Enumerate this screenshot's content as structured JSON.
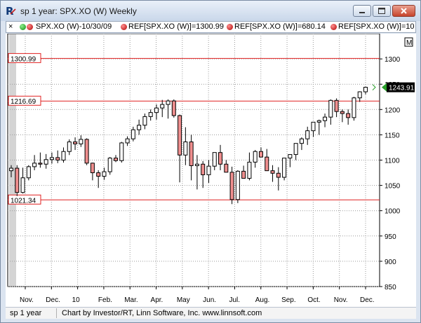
{
  "window": {
    "title": "sp 1 year: SPX.XO (W) Weekly"
  },
  "infobar": {
    "close_glyph": "×",
    "icons": [
      "green-dot-icon",
      "red-dot-icon"
    ],
    "symbol_label": "SPX.XO (W)-10/30/09",
    "ref1_label": "REF[SPX.XO (W)]=1300.99",
    "ref2_label": "REF[SPX.XO (W)]=680.14",
    "ref3_label": "REF[SPX.XO (W)]=10"
  },
  "status": {
    "chart_name": "sp 1 year",
    "credit": "Chart by Investor/RT, Linn Software, Inc. www.linnsoft.com"
  },
  "colors": {
    "up_candle": "#ffffff",
    "down_candle": "#f08f8f",
    "ref_line": "#e02020",
    "last_price_bg": "#000000",
    "last_price_marker": "#2aa02a",
    "highlight_column": "#d4d4d4"
  },
  "chart_data": {
    "type": "candlestick",
    "y_axis": {
      "min": 850,
      "max": 1350,
      "ticks": [
        850,
        900,
        950,
        1000,
        1050,
        1100,
        1150,
        1200,
        1250,
        1300
      ],
      "side": "right"
    },
    "x_tick_labels": [
      "Nov.",
      "Dec.",
      "10",
      "Feb.",
      "Mar.",
      "Apr.",
      "May",
      "Jun.",
      "Jul.",
      "Aug.",
      "Sep.",
      "Oct.",
      "Nov.",
      "Dec."
    ],
    "grid": true,
    "reference_lines": [
      {
        "label": "1300.99",
        "value": 1300.99
      },
      {
        "label": "1216.69",
        "value": 1216.69
      },
      {
        "label": "1021.34",
        "value": 1021.34
      }
    ],
    "last_price": {
      "label": "1243.91",
      "value": 1243.91
    },
    "corner_marker": "M",
    "candles": [
      [
        1079,
        1090,
        1066,
        1084
      ],
      [
        1084,
        1090,
        1029,
        1036
      ],
      [
        1036,
        1085,
        1034,
        1065
      ],
      [
        1065,
        1090,
        1060,
        1087
      ],
      [
        1087,
        1110,
        1080,
        1094
      ],
      [
        1094,
        1115,
        1085,
        1092
      ],
      [
        1092,
        1112,
        1083,
        1101
      ],
      [
        1101,
        1115,
        1093,
        1105
      ],
      [
        1105,
        1119,
        1094,
        1100
      ],
      [
        1100,
        1125,
        1095,
        1117
      ],
      [
        1117,
        1141,
        1110,
        1136
      ],
      [
        1136,
        1145,
        1120,
        1132
      ],
      [
        1132,
        1149,
        1126,
        1141
      ],
      [
        1141,
        1143,
        1090,
        1094
      ],
      [
        1094,
        1095,
        1060,
        1075
      ],
      [
        1075,
        1080,
        1045,
        1068
      ],
      [
        1068,
        1085,
        1061,
        1077
      ],
      [
        1077,
        1106,
        1071,
        1104
      ],
      [
        1104,
        1110,
        1096,
        1099
      ],
      [
        1099,
        1136,
        1095,
        1134
      ],
      [
        1134,
        1147,
        1128,
        1142
      ],
      [
        1142,
        1166,
        1137,
        1160
      ],
      [
        1160,
        1180,
        1150,
        1169
      ],
      [
        1169,
        1192,
        1161,
        1186
      ],
      [
        1186,
        1200,
        1178,
        1194
      ],
      [
        1194,
        1210,
        1180,
        1203
      ],
      [
        1203,
        1219,
        1185,
        1210
      ],
      [
        1210,
        1220,
        1182,
        1217
      ],
      [
        1217,
        1220,
        1184,
        1188
      ],
      [
        1188,
        1190,
        1056,
        1110
      ],
      [
        1110,
        1165,
        1090,
        1136
      ],
      [
        1136,
        1150,
        1060,
        1089
      ],
      [
        1089,
        1110,
        1042,
        1092
      ],
      [
        1092,
        1098,
        1045,
        1071
      ],
      [
        1071,
        1100,
        1055,
        1088
      ],
      [
        1088,
        1115,
        1080,
        1115
      ],
      [
        1115,
        1130,
        1080,
        1092
      ],
      [
        1092,
        1100,
        1076,
        1076
      ],
      [
        1076,
        1087,
        1013,
        1022
      ],
      [
        1022,
        1080,
        1015,
        1078
      ],
      [
        1078,
        1089,
        1065,
        1064
      ],
      [
        1064,
        1115,
        1060,
        1096
      ],
      [
        1096,
        1120,
        1085,
        1117
      ],
      [
        1117,
        1125,
        1107,
        1106
      ],
      [
        1106,
        1122,
        1100,
        1079
      ],
      [
        1079,
        1090,
        1057,
        1074
      ],
      [
        1074,
        1086,
        1040,
        1066
      ],
      [
        1066,
        1103,
        1060,
        1104
      ],
      [
        1104,
        1106,
        1086,
        1111
      ],
      [
        1111,
        1125,
        1100,
        1133
      ],
      [
        1133,
        1145,
        1120,
        1142
      ],
      [
        1142,
        1166,
        1130,
        1158
      ],
      [
        1158,
        1175,
        1146,
        1175
      ],
      [
        1175,
        1180,
        1150,
        1178
      ],
      [
        1178,
        1192,
        1165,
        1185
      ],
      [
        1185,
        1220,
        1170,
        1218
      ],
      [
        1218,
        1222,
        1185,
        1196
      ],
      [
        1196,
        1200,
        1175,
        1192
      ],
      [
        1192,
        1200,
        1170,
        1184
      ],
      [
        1184,
        1225,
        1178,
        1223
      ],
      [
        1223,
        1236,
        1215,
        1235
      ],
      [
        1235,
        1245,
        1230,
        1244
      ]
    ]
  }
}
